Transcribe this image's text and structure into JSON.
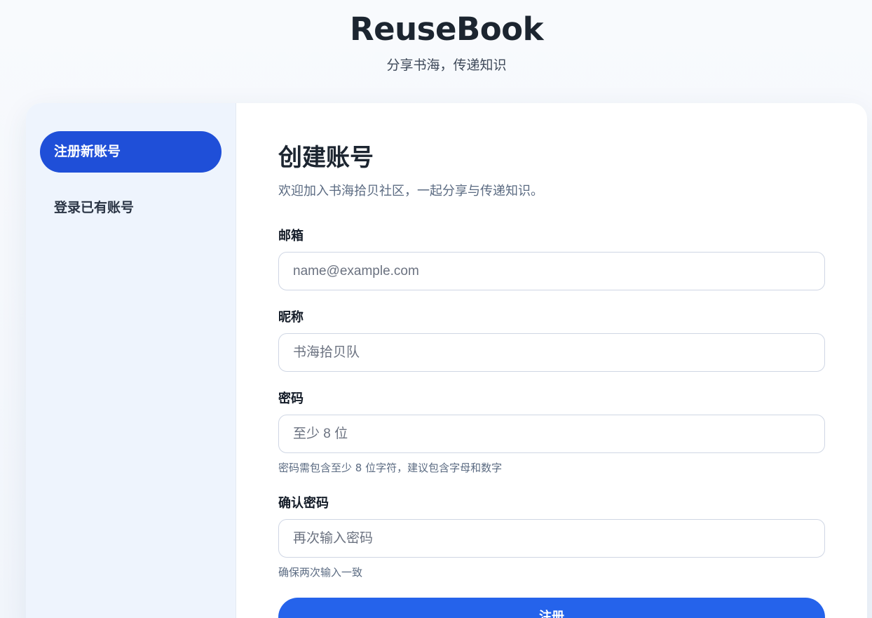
{
  "header": {
    "title": "ReuseBook",
    "subtitle": "分享书海，传递知识"
  },
  "sidebar": {
    "items": [
      {
        "label": "注册新账号",
        "active": true
      },
      {
        "label": "登录已有账号",
        "active": false
      }
    ]
  },
  "form": {
    "title": "创建账号",
    "description": "欢迎加入书海拾贝社区，一起分享与传递知识。",
    "fields": [
      {
        "label": "邮箱",
        "placeholder": "name@example.com",
        "value": "",
        "hint": ""
      },
      {
        "label": "昵称",
        "placeholder": "书海拾贝队",
        "value": "",
        "hint": ""
      },
      {
        "label": "密码",
        "placeholder": "至少 8 位",
        "value": "",
        "hint": "密码需包含至少 8 位字符，建议包含字母和数字"
      },
      {
        "label": "确认密码",
        "placeholder": "再次输入密码",
        "value": "",
        "hint": "确保两次输入一致"
      }
    ],
    "submit_label": "注册"
  },
  "colors": {
    "accent": "#1f4fd8",
    "button": "#2563eb",
    "sidebar_bg": "#eef4fd"
  }
}
